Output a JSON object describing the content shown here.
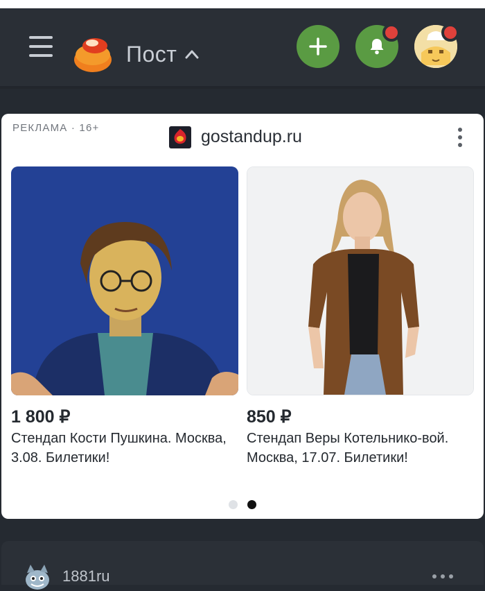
{
  "header": {
    "title": "Пост",
    "brand_color": "#5a9b43",
    "badge_color": "#e0413b",
    "icons": [
      "menu-icon",
      "pikabu-logo",
      "chevron-up-icon",
      "plus-icon",
      "bell-icon",
      "avatar"
    ]
  },
  "ad": {
    "label": "РЕКЛАМА · 16+",
    "site": "gostandup.ru",
    "products": [
      {
        "price": "1 800 ₽",
        "description": "Стендап Кости Пушкина. Москва, 3.08. Билетики!"
      },
      {
        "price": "850 ₽",
        "description": "Стендап Веры Котельнико-вой. Москва, 17.07. Билетики!"
      }
    ],
    "carousel": {
      "pages": 2,
      "active": 2
    }
  },
  "next_post": {
    "author": "1881ru"
  }
}
